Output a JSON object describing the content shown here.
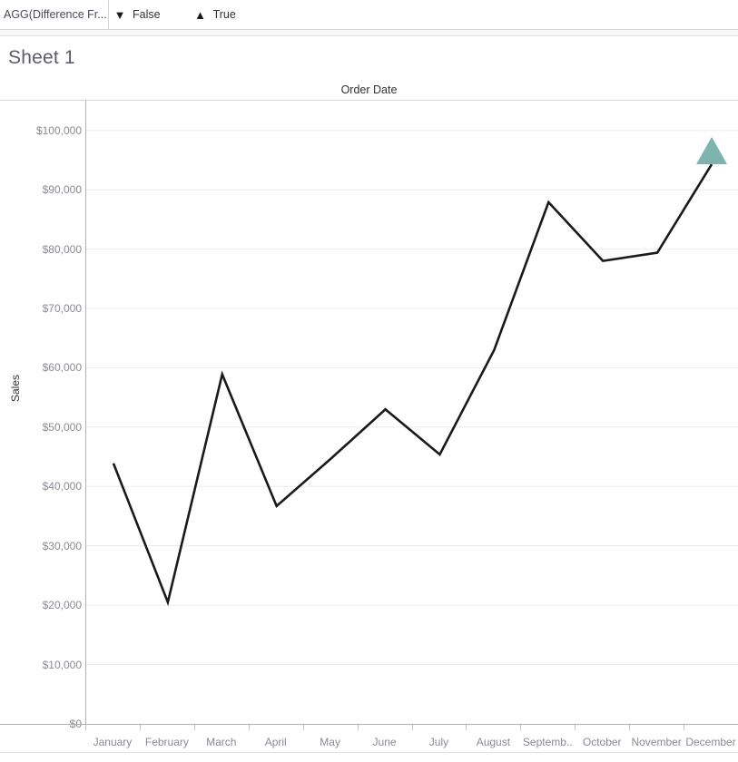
{
  "legend": {
    "title": "AGG(Difference Fr...",
    "items": [
      {
        "label": "False",
        "glyph": "▼",
        "glyph_name": "triangle-down-icon",
        "color": "#1a1a1a"
      },
      {
        "label": "True",
        "glyph": "▲",
        "glyph_name": "triangle-up-icon",
        "color": "#1a1a1a"
      }
    ]
  },
  "sheet": {
    "title": "Sheet 1"
  },
  "chart_data": {
    "type": "line",
    "title": "",
    "xlabel": "Order Date",
    "ylabel": "Sales",
    "categories": [
      "January",
      "February",
      "March",
      "April",
      "May",
      "June",
      "July",
      "August",
      "Septemb..",
      "October",
      "November",
      "December"
    ],
    "values": [
      43900,
      20500,
      58900,
      36700,
      44700,
      53000,
      45400,
      63000,
      87900,
      78000,
      79400,
      94300
    ],
    "ylim": [
      0,
      105000
    ],
    "y_ticks": [
      0,
      10000,
      20000,
      30000,
      40000,
      50000,
      60000,
      70000,
      80000,
      90000,
      100000
    ],
    "y_tick_labels": [
      "$0",
      "$10,000",
      "$20,000",
      "$30,000",
      "$40,000",
      "$50,000",
      "$60,000",
      "$70,000",
      "$80,000",
      "$90,000",
      "$100,000"
    ],
    "grid": true,
    "legend_position": "top",
    "line_color": "#1a1a1a",
    "line_width": 2.6,
    "markers": [
      {
        "category": "December",
        "value": 94300,
        "shape": "triangle-up",
        "color": "#7fb3ad",
        "legend_value": "True"
      }
    ]
  }
}
